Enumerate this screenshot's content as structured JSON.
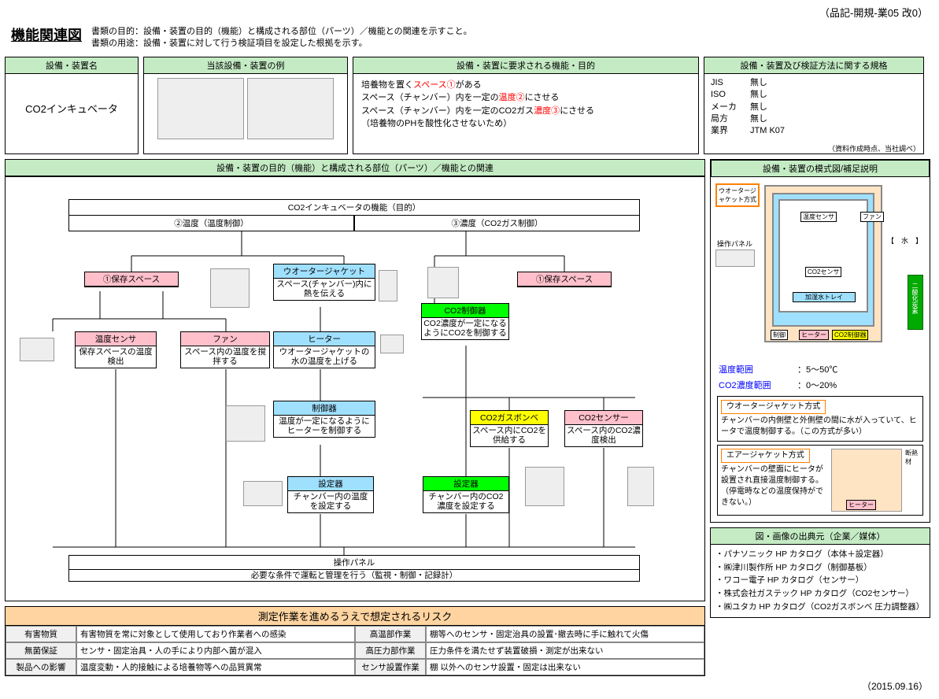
{
  "doc_id": "（品記-開規-業05 改0）",
  "title": "機能関連図",
  "purpose_line1": "書類の目的：設備・装置の目的（機能）と構成される部位（パーツ）／機能との関連を示すこと。",
  "purpose_line2": "書類の用途：設備・装置に対して行う検証項目を設定した根拠を示す。",
  "panels": {
    "equip_name_title": "設備・装置名",
    "equip_name": "CO2インキュベータ",
    "equip_photo_title": "当該設備・装置の例",
    "req_func_title": "設備・装置に要求される機能・目的",
    "req_func": {
      "l1a": "培養物を置く",
      "l1b": "スペース①",
      "l1c": "がある",
      "l2a": "スペース（チャンバー）内を一定の",
      "l2b": "温度②",
      "l2c": "にさせる",
      "l3a": "スペース（チャンバー）内を一定のCO2ガス",
      "l3b": "濃度③",
      "l3c": "にさせる",
      "l4": "（培養物のPHを酸性化させないため）"
    },
    "stds_title": "設備・装置及び検証方法に関する規格",
    "stds": [
      {
        "k": "JIS",
        "v": "無し"
      },
      {
        "k": "ISO",
        "v": "無し"
      },
      {
        "k": "メーカ",
        "v": "無し"
      },
      {
        "k": "局方",
        "v": "無し"
      },
      {
        "k": "業界",
        "v": "JTM K07"
      }
    ],
    "stds_note": "（資料作成時点、当社調べ）"
  },
  "section_main": "設備・装置の目的（機能）と構成される部位（パーツ）／機能との関連",
  "diagram": {
    "root": "CO2インキュベータの機能（目的）",
    "branch_temp": "②温度（温度制御）",
    "branch_co2": "③濃度（CO2ガス制御）",
    "space1": "①保存スペース",
    "space2": "①保存スペース",
    "waterjacket": {
      "t": "ウオータージャケット",
      "b": "スペース(チャンバー)内に熱を伝える"
    },
    "tempsensor": {
      "t": "温度センサ",
      "b": "保存スペースの温度検出"
    },
    "fan": {
      "t": "ファン",
      "b": "スペース内の温度を撹拌する"
    },
    "heater": {
      "t": "ヒーター",
      "b": "ウオータージャケットの水の温度を上げる"
    },
    "controller": {
      "t": "制御器",
      "b": "温度が一定になるようにヒーターを制御する"
    },
    "setter_temp": {
      "t": "設定器",
      "b": "チャンバー内の温度を設定する"
    },
    "co2ctrl": {
      "t": "CO2制御器",
      "b": "CO2濃度が一定になるようにCO2を制御する"
    },
    "co2bomb": {
      "t": "CO2ガスボンベ",
      "b": "スペース内にCO2を供給する"
    },
    "co2sensor": {
      "t": "CO2センサー",
      "b": "スペース内のCO2濃度検出"
    },
    "setter_co2": {
      "t": "設定器",
      "b": "チャンバー内のCO2濃度を設定する"
    },
    "oppanel": {
      "t": "操作パネル",
      "b": "必要な条件で運転と管理を行う（監視・制御・記録計）"
    }
  },
  "schematic": {
    "title": "設備・装置の模式図/補足説明",
    "labels": {
      "wj": "ウオータージャケット方式",
      "oppanel": "操作パネル",
      "tempsensor": "温度センサ",
      "fan": "ファン",
      "water": "【　水　】",
      "co2sensor": "CO2センサ",
      "humid": "加湿水トレイ",
      "ctrl": "制御",
      "heater": "ヒーター",
      "co2ctrl": "CO2制御器",
      "co2gas": "二酸化炭素"
    },
    "specs": [
      {
        "k": "温度範囲",
        "v": "：5～50℃"
      },
      {
        "k": "CO2濃度範囲",
        "v": "：0～20%"
      }
    ],
    "method1": {
      "t": "ウオータージャケット方式",
      "b": "チャンバーの内側壁と外側壁の間に水が入っていて、ヒータで温度制御する。（この方式が多い）"
    },
    "method2": {
      "t": "エアージャケット方式",
      "b": "チャンバーの壁面にヒータが設置され直接温度制御する。（停電時などの温度保持ができない。）",
      "heater": "ヒーター",
      "insul": "断熱材"
    }
  },
  "sources": {
    "title": "図・画像の出典元（企業／媒体）",
    "items": [
      "・パナソニック HP カタログ（本体＋設定器）",
      "・㈱津川製作所 HP カタログ（制御基板）",
      "・ワコー電子 HP カタログ（センサー）",
      "・株式会社ガステック HP カタログ（CO2センサー）",
      "・㈱ユタカ HP カタログ（CO2ガスボンベ 圧力調整器）"
    ]
  },
  "risk": {
    "title": "測定作業を進めるうえで想定されるリスク",
    "rows": [
      [
        "有害物質",
        "有害物質を常に対象として使用しており作業者への感染",
        "高温部作業",
        "棚等へのセンサ・固定治具の設置･撤去時に手に触れて火傷"
      ],
      [
        "無菌保証",
        "センサ・固定治具・人の手により内部へ菌が混入",
        "高圧力部作業",
        "圧力条件を満たせず装置破損・測定が出来ない"
      ],
      [
        "製品への影響",
        "温度変動・人的接触による培養物等への品質異常",
        "センサ設置作業",
        "棚 以外へのセンサ設置・固定は出来ない"
      ]
    ]
  },
  "date": "（2015.09.16）"
}
